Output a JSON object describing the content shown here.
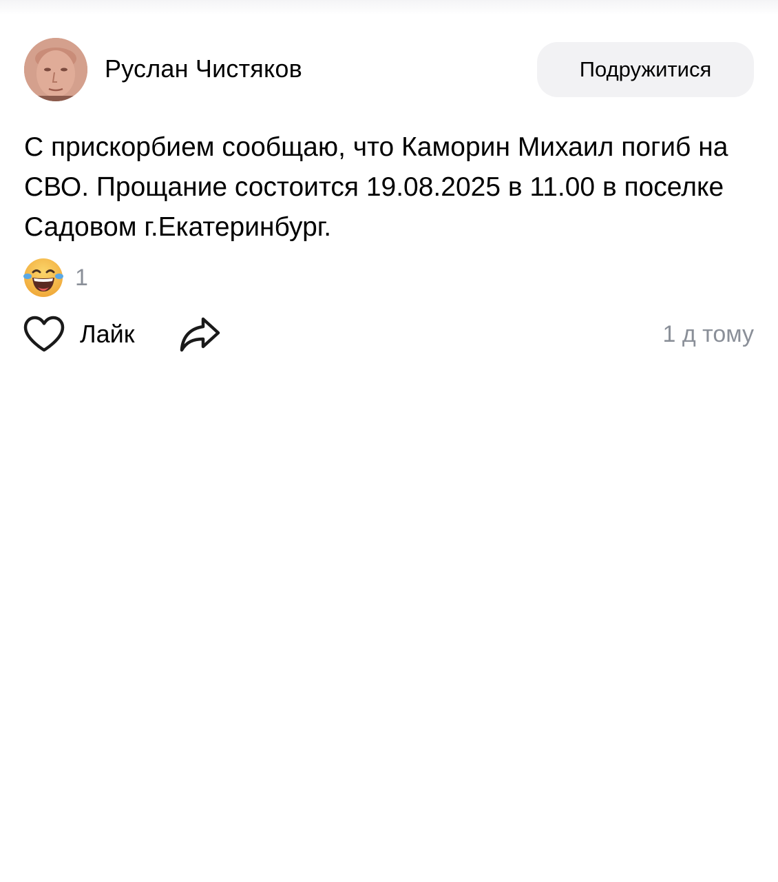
{
  "post": {
    "author_name": "Руслан Чистяков",
    "friend_button_label": "Подружитися",
    "text": "С прискорбием сообщаю, что Каморин Михаил погиб на СВО. Прощание состоится 19.08.2025 в 11.00 в поселке Садовом г.Екатеринбург.",
    "reaction": {
      "icon": "laughing-tears-emoji-icon",
      "count": "1"
    },
    "like_label": "Лайк",
    "like_icon": "heart-outline-icon",
    "share_icon": "share-arrow-icon",
    "time_ago": "1 д тому"
  },
  "colors": {
    "secondary_text": "#8a8f98",
    "button_bg": "#f2f2f4",
    "emoji_yellow": "#f7c04a",
    "emoji_tears": "#5aa8e6"
  }
}
